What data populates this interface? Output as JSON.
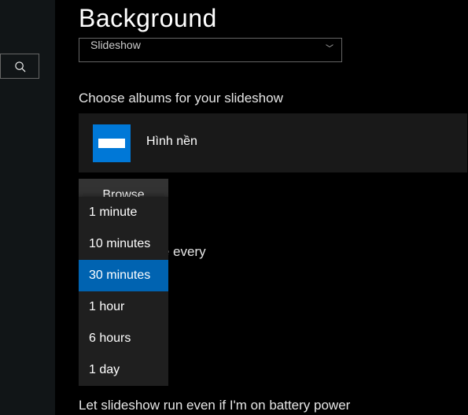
{
  "page": {
    "title": "Background"
  },
  "background_dropdown": {
    "selected_label": "Slideshow"
  },
  "albums": {
    "label": "Choose albums for your slideshow",
    "selected": {
      "name": "Hình nền"
    },
    "browse_label": "Browse"
  },
  "change_picture": {
    "label": "Change picture every",
    "options": [
      {
        "label": "1 minute",
        "selected": false
      },
      {
        "label": "10 minutes",
        "selected": false
      },
      {
        "label": "30 minutes",
        "selected": true
      },
      {
        "label": "1 hour",
        "selected": false
      },
      {
        "label": "6 hours",
        "selected": false
      },
      {
        "label": "1 day",
        "selected": false
      }
    ]
  },
  "battery": {
    "label": "Let slideshow run even if I'm on battery power"
  }
}
